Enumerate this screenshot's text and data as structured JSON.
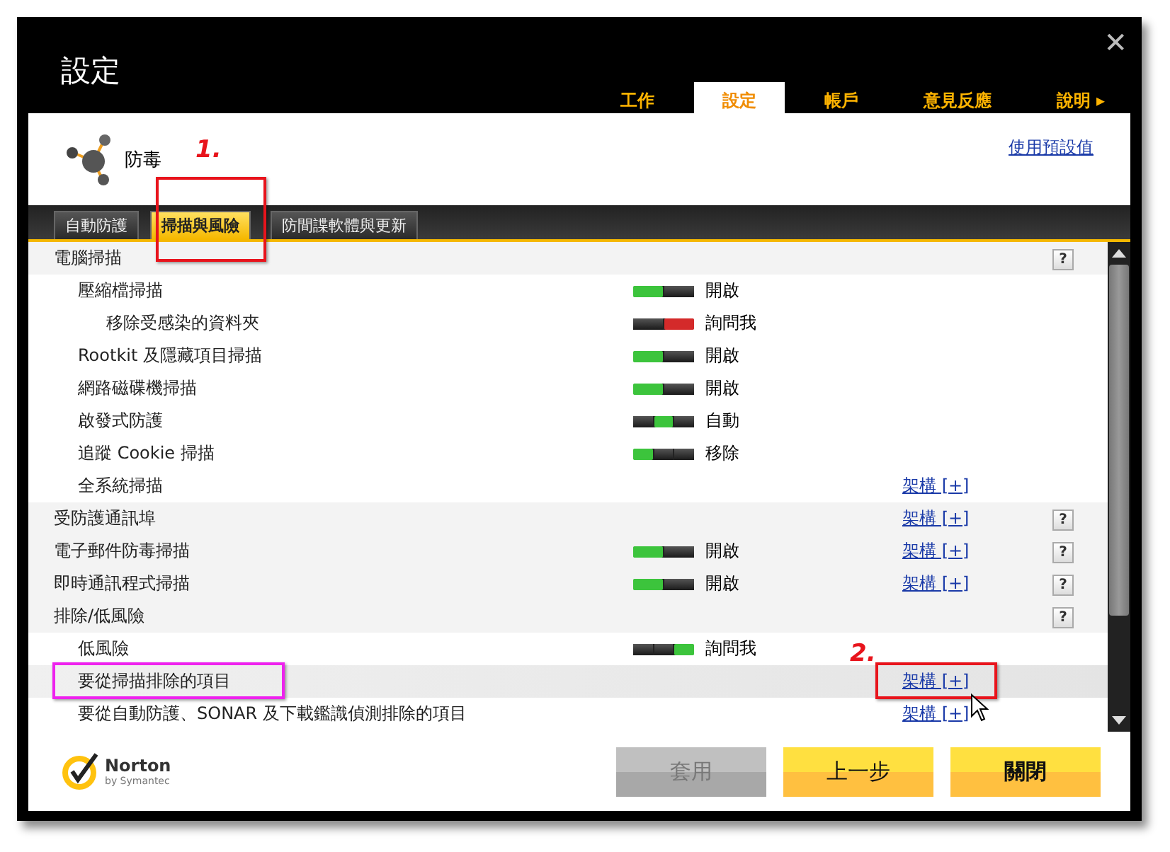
{
  "window": {
    "title": "設定",
    "close": "✕"
  },
  "nav_tabs": [
    {
      "label": "工作",
      "selected": false
    },
    {
      "label": "設定",
      "selected": true
    },
    {
      "label": "帳戶",
      "selected": false
    },
    {
      "label": "意見反應",
      "selected": false
    },
    {
      "label": "說明 ▸",
      "selected": false
    }
  ],
  "section": {
    "title": "防毒",
    "reset_link": "使用預設值"
  },
  "tabs": [
    {
      "label": "自動防護",
      "selected": false
    },
    {
      "label": "掃描與風險",
      "selected": true
    },
    {
      "label": "防間諜軟體與更新",
      "selected": false
    }
  ],
  "rows": [
    {
      "label": "電腦掃描",
      "help": "?",
      "hovered": false,
      "children": [
        {
          "label": "壓縮檔掃描",
          "hovered": false,
          "toggle": {
            "segments": [
              {
                "selected": true
              },
              {
                "selected": false
              }
            ],
            "color": "#3cc43c"
          },
          "status": "開啟",
          "children": [
            {
              "label": "移除受感染的資料夾",
              "hovered": false,
              "toggle": {
                "segments": [
                  {
                    "selected": false
                  },
                  {
                    "selected": true
                  }
                ],
                "color": "#d42a2a"
              },
              "status": "詢問我"
            }
          ]
        },
        {
          "label": "Rootkit 及隱藏項目掃描",
          "hovered": false,
          "toggle": {
            "segments": [
              {
                "selected": true
              },
              {
                "selected": false
              }
            ],
            "color": "#3cc43c"
          },
          "status": "開啟"
        },
        {
          "label": "網路磁碟機掃描",
          "hovered": false,
          "toggle": {
            "segments": [
              {
                "selected": true
              },
              {
                "selected": false
              }
            ],
            "color": "#3cc43c"
          },
          "status": "開啟"
        },
        {
          "label": "啟發式防護",
          "hovered": false,
          "toggle": {
            "segments": [
              {
                "selected": false
              },
              {
                "selected": true
              },
              {
                "selected": false
              }
            ],
            "color": "#3cc43c"
          },
          "status": "自動"
        },
        {
          "label": "追蹤 Cookie 掃描",
          "hovered": false,
          "toggle": {
            "segments": [
              {
                "selected": true
              },
              {
                "selected": false
              },
              {
                "selected": false
              }
            ],
            "color": "#3cc43c"
          },
          "status": "移除"
        },
        {
          "label": "全系統掃描",
          "hovered": false,
          "link": "架構 [+]"
        }
      ]
    },
    {
      "label": "受防護通訊埠",
      "hovered": false,
      "link": "架構 [+]",
      "help": "?"
    },
    {
      "label": "電子郵件防毒掃描",
      "hovered": false,
      "toggle": {
        "segments": [
          {
            "selected": true
          },
          {
            "selected": false
          }
        ],
        "color": "#3cc43c"
      },
      "status": "開啟",
      "link": "架構 [+]",
      "help": "?"
    },
    {
      "label": "即時通訊程式掃描",
      "hovered": false,
      "toggle": {
        "segments": [
          {
            "selected": true
          },
          {
            "selected": false
          }
        ],
        "color": "#3cc43c"
      },
      "status": "開啟",
      "link": "架構 [+]",
      "help": "?"
    },
    {
      "label": "排除/低風險",
      "hovered": false,
      "help": "?",
      "children": [
        {
          "label": "低風險",
          "hovered": false,
          "toggle": {
            "segments": [
              {
                "selected": false
              },
              {
                "selected": false
              },
              {
                "selected": true
              }
            ],
            "color": "#3cc43c"
          },
          "status": "詢問我"
        },
        {
          "label": "要從掃描排除的項目",
          "hovered": true,
          "link": "架構 [+]"
        },
        {
          "label": "要從自動防護、SONAR 及下載鑑識偵測排除的項目",
          "hovered": false,
          "link": "架構 [+]"
        }
      ]
    }
  ],
  "buttons": [
    {
      "label": "套用",
      "disabled": true,
      "primary": false
    },
    {
      "label": "上一步",
      "disabled": false,
      "primary": false
    },
    {
      "label": "關閉",
      "disabled": false,
      "primary": true
    }
  ],
  "logo": {
    "name": "Norton",
    "tagline": "by Symantec"
  },
  "annotations": [
    {
      "kind": "tab-box",
      "label": "1.",
      "color": "#e8141c"
    },
    {
      "kind": "row-box",
      "color": "#ee22ee"
    },
    {
      "kind": "link-box",
      "label": "2.",
      "color": "#e8141c"
    }
  ]
}
